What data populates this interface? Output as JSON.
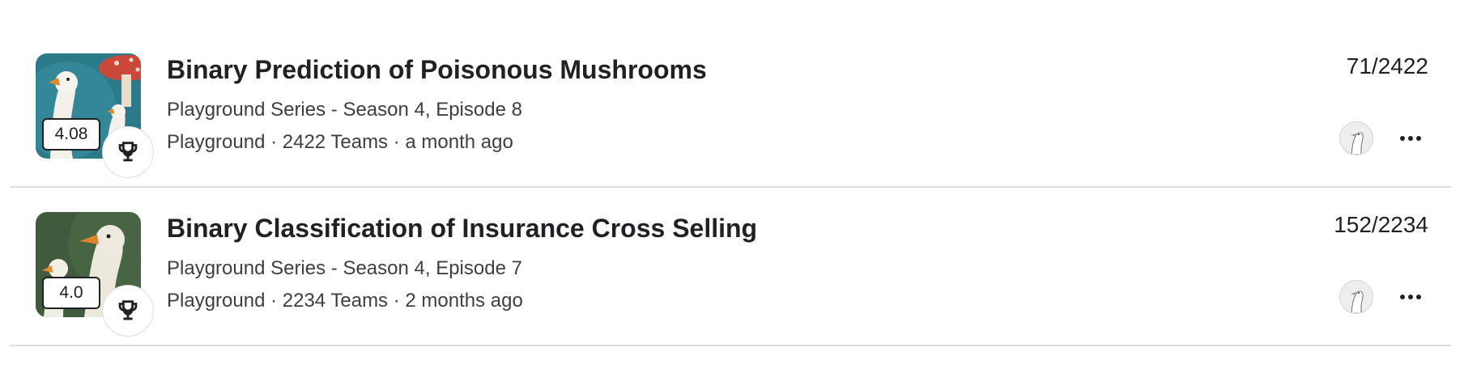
{
  "competitions": [
    {
      "title": "Binary Prediction of Poisonous Mushrooms",
      "subtitle": "Playground Series - Season 4, Episode 8",
      "meta": "Playground · 2422 Teams · a month ago",
      "score": "4.08",
      "rank": "71/2422",
      "thumb_icon": "goose-mushroom-thumbnail",
      "badge_icon": "trophy-icon"
    },
    {
      "title": "Binary Classification of Insurance Cross Selling",
      "subtitle": "Playground Series - Season 4, Episode 7",
      "meta": "Playground · 2234 Teams · 2 months ago",
      "score": "4.0",
      "rank": "152/2234",
      "thumb_icon": "goose-thumbnail",
      "badge_icon": "trophy-icon"
    }
  ],
  "colors": {
    "text_primary": "#202124",
    "text_secondary": "#3c4043",
    "divider": "#dadce0"
  },
  "icons": {
    "avatar": "goose-avatar-icon",
    "more": "more-horizontal-icon"
  }
}
